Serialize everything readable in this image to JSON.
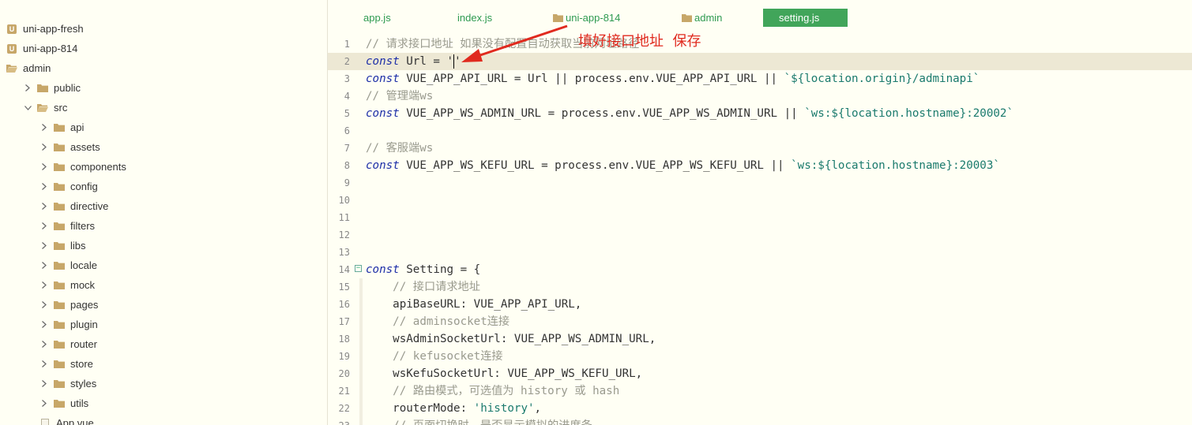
{
  "tabs": [
    {
      "label": "app.js",
      "type": "file"
    },
    {
      "label": "index.js",
      "type": "file"
    },
    {
      "label": "uni-app-814",
      "type": "folder"
    },
    {
      "label": "admin",
      "type": "folder"
    },
    {
      "label": "setting.js",
      "type": "file",
      "active": true
    }
  ],
  "sidebar": {
    "items": [
      {
        "label": "uni-app-fresh",
        "icon": "project-icon",
        "expanded": null
      },
      {
        "label": "uni-app-814",
        "icon": "project-icon",
        "expanded": null
      },
      {
        "label": "admin",
        "icon": "folder-open-icon",
        "expanded": null
      },
      {
        "label": "public",
        "icon": "folder-icon",
        "expanded": false
      },
      {
        "label": "src",
        "icon": "folder-open-icon",
        "expanded": true
      },
      {
        "label": "api",
        "icon": "folder-icon",
        "expanded": false
      },
      {
        "label": "assets",
        "icon": "folder-icon",
        "expanded": false
      },
      {
        "label": "components",
        "icon": "folder-icon",
        "expanded": false
      },
      {
        "label": "config",
        "icon": "folder-icon",
        "expanded": false
      },
      {
        "label": "directive",
        "icon": "folder-icon",
        "expanded": false
      },
      {
        "label": "filters",
        "icon": "folder-icon",
        "expanded": false
      },
      {
        "label": "libs",
        "icon": "folder-icon",
        "expanded": false
      },
      {
        "label": "locale",
        "icon": "folder-icon",
        "expanded": false
      },
      {
        "label": "mock",
        "icon": "folder-icon",
        "expanded": false
      },
      {
        "label": "pages",
        "icon": "folder-icon",
        "expanded": false
      },
      {
        "label": "plugin",
        "icon": "folder-icon",
        "expanded": false
      },
      {
        "label": "router",
        "icon": "folder-icon",
        "expanded": false
      },
      {
        "label": "store",
        "icon": "folder-icon",
        "expanded": false
      },
      {
        "label": "styles",
        "icon": "folder-icon",
        "expanded": false
      },
      {
        "label": "utils",
        "icon": "folder-icon",
        "expanded": false
      },
      {
        "label": "App.vue",
        "icon": "file-icon",
        "expanded": null
      }
    ]
  },
  "editor": {
    "current_line": 2,
    "lines": [
      {
        "n": "1",
        "segs": [
          {
            "t": "// 请求接口地址 如果没有配置自动获取当前网址路径",
            "c": "cm"
          }
        ]
      },
      {
        "n": "2",
        "segs": [
          {
            "t": "const",
            "c": "kw"
          },
          {
            "t": " Url = '",
            "c": ""
          },
          {
            "t": "|caret|",
            "c": "caret"
          },
          {
            "t": "'",
            "c": ""
          }
        ]
      },
      {
        "n": "3",
        "segs": [
          {
            "t": "const",
            "c": "kw"
          },
          {
            "t": " VUE_APP_API_URL = Url || process.env.VUE_APP_API_URL || ",
            "c": ""
          },
          {
            "t": "`${location.origin}/adminapi`",
            "c": "str"
          }
        ]
      },
      {
        "n": "4",
        "segs": [
          {
            "t": "// 管理端ws",
            "c": "cm"
          }
        ]
      },
      {
        "n": "5",
        "segs": [
          {
            "t": "const",
            "c": "kw"
          },
          {
            "t": " VUE_APP_WS_ADMIN_URL = process.env.VUE_APP_WS_ADMIN_URL || ",
            "c": ""
          },
          {
            "t": "`ws:${location.hostname}:20002`",
            "c": "str"
          }
        ]
      },
      {
        "n": "6",
        "segs": []
      },
      {
        "n": "7",
        "segs": [
          {
            "t": "// 客服端ws",
            "c": "cm"
          }
        ]
      },
      {
        "n": "8",
        "segs": [
          {
            "t": "const",
            "c": "kw"
          },
          {
            "t": " VUE_APP_WS_KEFU_URL = process.env.VUE_APP_WS_KEFU_URL || ",
            "c": ""
          },
          {
            "t": "`ws:${location.hostname}:20003`",
            "c": "str"
          }
        ]
      },
      {
        "n": "9",
        "segs": []
      },
      {
        "n": "10",
        "segs": []
      },
      {
        "n": "11",
        "segs": []
      },
      {
        "n": "12",
        "segs": []
      },
      {
        "n": "13",
        "segs": []
      },
      {
        "n": "14",
        "fold": true,
        "segs": [
          {
            "t": "const",
            "c": "kw"
          },
          {
            "t": " Setting = {",
            "c": ""
          }
        ]
      },
      {
        "n": "15",
        "indent": true,
        "segs": [
          {
            "t": "    // 接口请求地址",
            "c": "cm"
          }
        ]
      },
      {
        "n": "16",
        "indent": true,
        "segs": [
          {
            "t": "    apiBaseURL: VUE_APP_API_URL,",
            "c": ""
          }
        ]
      },
      {
        "n": "17",
        "indent": true,
        "segs": [
          {
            "t": "    // adminsocket连接",
            "c": "cm"
          }
        ]
      },
      {
        "n": "18",
        "indent": true,
        "segs": [
          {
            "t": "    wsAdminSocketUrl: VUE_APP_WS_ADMIN_URL,",
            "c": ""
          }
        ]
      },
      {
        "n": "19",
        "indent": true,
        "segs": [
          {
            "t": "    // kefusocket连接",
            "c": "cm"
          }
        ]
      },
      {
        "n": "20",
        "indent": true,
        "segs": [
          {
            "t": "    wsKefuSocketUrl: VUE_APP_WS_KEFU_URL,",
            "c": ""
          }
        ]
      },
      {
        "n": "21",
        "indent": true,
        "segs": [
          {
            "t": "    // 路由模式，可选值为 history 或 hash",
            "c": "cm"
          }
        ]
      },
      {
        "n": "22",
        "indent": true,
        "segs": [
          {
            "t": "    routerMode: ",
            "c": ""
          },
          {
            "t": "'history'",
            "c": "str"
          },
          {
            "t": ",",
            "c": ""
          }
        ]
      },
      {
        "n": "23",
        "indent": true,
        "segs": [
          {
            "t": "    // 页面切换时，是否显示模拟的进度条",
            "c": "cm"
          }
        ]
      }
    ]
  },
  "annotation": {
    "text": "填好接口地址  保存",
    "color": "#e02a1f"
  },
  "colors": {
    "accent": "#41a55a",
    "background": "#fffff4",
    "keyword": "#1e2fa8",
    "comment": "#999a8e",
    "string": "#1a7a6d"
  }
}
